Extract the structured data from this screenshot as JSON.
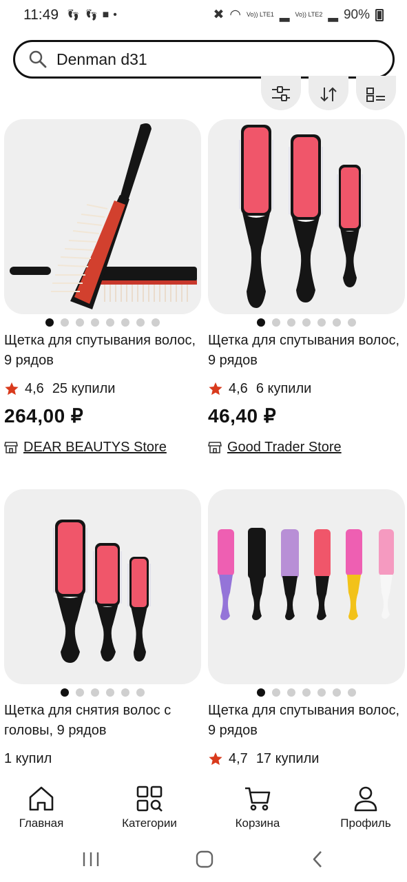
{
  "status_bar": {
    "time": "11:49",
    "sim1": "Vo)) LTE1",
    "sim2": "Vo)) LTE2",
    "battery": "90%"
  },
  "search": {
    "value": "Denman d31"
  },
  "products": [
    {
      "title": "Щетка для спутывания волос, 9 рядов",
      "rating": "4,6",
      "bought": "25 купили",
      "price": "264,00 ₽",
      "store": "DEAR BEAUTYS Store",
      "image_dots": 8,
      "active_dot": 0
    },
    {
      "title": "Щетка для спутывания волос, 9 рядов",
      "rating": "4,6",
      "bought": "6 купили",
      "price": "46,40 ₽",
      "store": "Good Trader Store",
      "image_dots": 7,
      "active_dot": 0
    },
    {
      "title": "Щетка для снятия волос с головы, 9 рядов",
      "bought": "1 купил",
      "image_dots": 6,
      "active_dot": 0
    },
    {
      "title": "Щетка для спутывания волос, 9 рядов",
      "rating": "4,7",
      "bought": "17 купили",
      "image_dots": 7,
      "active_dot": 0
    }
  ],
  "bottom_nav": {
    "home": "Главная",
    "categories": "Категории",
    "cart": "Корзина",
    "profile": "Профиль"
  },
  "colors": {
    "star": "#d93a1c",
    "brush_pink": "#f0566a",
    "brush_black": "#151515",
    "card_bg": "#efefef"
  }
}
